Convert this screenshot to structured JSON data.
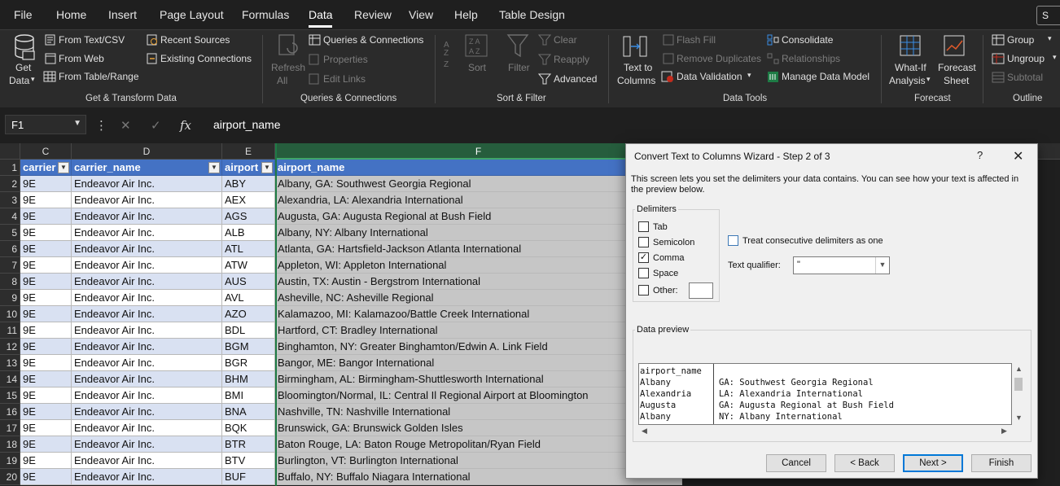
{
  "menu": {
    "items": [
      "File",
      "Home",
      "Insert",
      "Page Layout",
      "Formulas",
      "Data",
      "Review",
      "View",
      "Help",
      "Table Design"
    ],
    "active": "Data",
    "share_label": "S"
  },
  "ribbon": {
    "get_data": {
      "line1": "Get",
      "line2": "Data"
    },
    "from_text_csv": "From Text/CSV",
    "from_web": "From Web",
    "from_table_range": "From Table/Range",
    "recent_sources": "Recent Sources",
    "existing_connections": "Existing Connections",
    "group_get_transform": "Get & Transform Data",
    "refresh_all": {
      "line1": "Refresh",
      "line2": "All"
    },
    "queries_connections": "Queries & Connections",
    "properties": "Properties",
    "edit_links": "Edit Links",
    "group_queries": "Queries & Connections",
    "sort": "Sort",
    "filter": "Filter",
    "clear": "Clear",
    "reapply": "Reapply",
    "advanced": "Advanced",
    "group_sort_filter": "Sort & Filter",
    "text_to_columns": {
      "line1": "Text to",
      "line2": "Columns"
    },
    "flash_fill": "Flash Fill",
    "remove_duplicates": "Remove Duplicates",
    "data_validation": "Data Validation",
    "consolidate": "Consolidate",
    "relationships": "Relationships",
    "manage_data_model": "Manage Data Model",
    "group_data_tools": "Data Tools",
    "what_if": {
      "line1": "What-If",
      "line2": "Analysis"
    },
    "forecast_sheet": {
      "line1": "Forecast",
      "line2": "Sheet"
    },
    "group_forecast": "Forecast",
    "group": "Group",
    "ungroup": "Ungroup",
    "subtotal": "Subtotal",
    "group_outline": "Outline"
  },
  "formula_bar": {
    "name_box": "F1",
    "formula": "airport_name",
    "fx": "fx"
  },
  "grid": {
    "columns": [
      "C",
      "D",
      "E",
      "F"
    ],
    "headers": [
      "carrier",
      "carrier_name",
      "airport",
      "airport_name"
    ],
    "row_numbers": [
      "1",
      "2",
      "3",
      "4",
      "5",
      "6",
      "7",
      "8",
      "9",
      "10",
      "11",
      "12",
      "13",
      "14",
      "15",
      "16",
      "17",
      "18",
      "19",
      "20"
    ],
    "rows": [
      [
        "9E",
        "Endeavor Air Inc.",
        "ABY",
        "Albany, GA: Southwest Georgia Regional"
      ],
      [
        "9E",
        "Endeavor Air Inc.",
        "AEX",
        "Alexandria, LA: Alexandria International"
      ],
      [
        "9E",
        "Endeavor Air Inc.",
        "AGS",
        "Augusta, GA: Augusta Regional at Bush Field"
      ],
      [
        "9E",
        "Endeavor Air Inc.",
        "ALB",
        "Albany, NY: Albany International"
      ],
      [
        "9E",
        "Endeavor Air Inc.",
        "ATL",
        "Atlanta, GA: Hartsfield-Jackson Atlanta International"
      ],
      [
        "9E",
        "Endeavor Air Inc.",
        "ATW",
        "Appleton, WI: Appleton International"
      ],
      [
        "9E",
        "Endeavor Air Inc.",
        "AUS",
        "Austin, TX: Austin - Bergstrom International"
      ],
      [
        "9E",
        "Endeavor Air Inc.",
        "AVL",
        "Asheville, NC: Asheville Regional"
      ],
      [
        "9E",
        "Endeavor Air Inc.",
        "AZO",
        "Kalamazoo, MI: Kalamazoo/Battle Creek International"
      ],
      [
        "9E",
        "Endeavor Air Inc.",
        "BDL",
        "Hartford, CT: Bradley International"
      ],
      [
        "9E",
        "Endeavor Air Inc.",
        "BGM",
        "Binghamton, NY: Greater Binghamton/Edwin A. Link Field"
      ],
      [
        "9E",
        "Endeavor Air Inc.",
        "BGR",
        "Bangor, ME: Bangor International"
      ],
      [
        "9E",
        "Endeavor Air Inc.",
        "BHM",
        "Birmingham, AL: Birmingham-Shuttlesworth International"
      ],
      [
        "9E",
        "Endeavor Air Inc.",
        "BMI",
        "Bloomington/Normal, IL: Central Il Regional Airport at Bloomington"
      ],
      [
        "9E",
        "Endeavor Air Inc.",
        "BNA",
        "Nashville, TN: Nashville International"
      ],
      [
        "9E",
        "Endeavor Air Inc.",
        "BQK",
        "Brunswick, GA: Brunswick Golden Isles"
      ],
      [
        "9E",
        "Endeavor Air Inc.",
        "BTR",
        "Baton Rouge, LA: Baton Rouge Metropolitan/Ryan Field"
      ],
      [
        "9E",
        "Endeavor Air Inc.",
        "BTV",
        "Burlington, VT: Burlington International"
      ],
      [
        "9E",
        "Endeavor Air Inc.",
        "BUF",
        "Buffalo, NY: Buffalo Niagara International"
      ]
    ]
  },
  "dialog": {
    "title": "Convert Text to Columns Wizard - Step 2 of 3",
    "help": "?",
    "close": "✕",
    "description": "This screen lets you set the delimiters your data contains.  You can see how your text is affected in the preview below.",
    "delimiters_legend": "Delimiters",
    "delimiters": [
      {
        "label": "Tab",
        "checked": false
      },
      {
        "label": "Semicolon",
        "checked": false
      },
      {
        "label": "Comma",
        "checked": true
      },
      {
        "label": "Space",
        "checked": false
      },
      {
        "label": "Other:",
        "checked": false
      }
    ],
    "other_value": "",
    "consecutive_label": "Treat consecutive delimiters as one",
    "consecutive_checked": false,
    "text_qualifier_label": "Text qualifier:",
    "text_qualifier_value": "\"",
    "preview_legend": "Data preview",
    "preview_col1": [
      "airport_name",
      "Albany",
      "Alexandria",
      "Augusta",
      "Albany"
    ],
    "preview_col2": [
      "",
      "GA: Southwest Georgia Regional",
      "LA: Alexandria International",
      "GA: Augusta Regional at Bush Field",
      "NY: Albany International"
    ],
    "buttons": {
      "cancel": "Cancel",
      "back": "< Back",
      "next": "Next >",
      "finish": "Finish"
    },
    "check_mark": "✓"
  }
}
